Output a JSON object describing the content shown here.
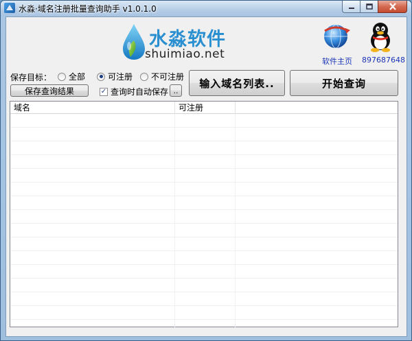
{
  "window": {
    "title": "水淼·域名注册批量查询助手 v1.0.1.0"
  },
  "header": {
    "logo_cn": "水淼软件",
    "logo_en": "shuimiao.net",
    "home_label": "软件主页",
    "qq_label": "897687648"
  },
  "options": {
    "save_target_label": "保存目标：",
    "radio_all": "全部",
    "radio_available": "可注册",
    "radio_unavailable": "不可注册",
    "selected": "可注册",
    "save_results_button": "保存查询结果",
    "auto_save_label": "查询时自动保存",
    "auto_save_checked": true,
    "browse_button": ".."
  },
  "actions": {
    "input_list_button": "输入域名列表..",
    "start_query_button": "开始查询"
  },
  "table": {
    "columns": [
      "域名",
      "可注册",
      ""
    ],
    "rows": []
  },
  "colors": {
    "link": "#1a34b8",
    "logo_blue": "#2a8fd0",
    "close_red": "#c44a2f"
  }
}
